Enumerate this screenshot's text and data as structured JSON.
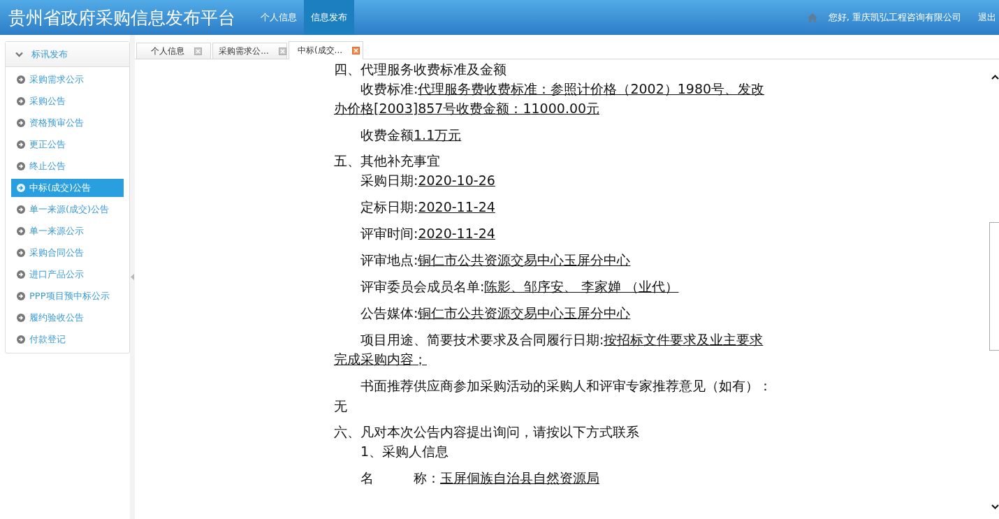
{
  "header": {
    "title": "贵州省政府采购信息发布平台",
    "nav": [
      {
        "label": "个人信息",
        "selected": false
      },
      {
        "label": "信息发布",
        "selected": true
      }
    ],
    "greeting": "您好, 重庆凯弘工程咨询有限公司",
    "logout": "退出"
  },
  "sidebar": {
    "title": "标讯发布",
    "expanded": true,
    "items": [
      {
        "label": "采购需求公示",
        "selected": false
      },
      {
        "label": "采购公告",
        "selected": false
      },
      {
        "label": "资格预审公告",
        "selected": false
      },
      {
        "label": "更正公告",
        "selected": false
      },
      {
        "label": "终止公告",
        "selected": false
      },
      {
        "label": "中标(成交)公告",
        "selected": true
      },
      {
        "label": "单一来源(成交)公告",
        "selected": false
      },
      {
        "label": "单一来源公示",
        "selected": false
      },
      {
        "label": "采购合同公告",
        "selected": false
      },
      {
        "label": "进口产品公示",
        "selected": false
      },
      {
        "label": "PPP项目预中标公示",
        "selected": false
      },
      {
        "label": "履约验收公告",
        "selected": false
      },
      {
        "label": "付款登记",
        "selected": false
      }
    ]
  },
  "tabs": [
    {
      "label": "个人信息",
      "selected": false
    },
    {
      "label": "采购需求公...",
      "selected": false
    },
    {
      "label": "中标(成交...",
      "selected": true
    }
  ],
  "document": [
    {
      "kind": "heading",
      "text": "四、代理服务收费标准及金额"
    },
    {
      "kind": "field",
      "label": "收费标准:",
      "value": "代理服务费收费标准：参照计价格（2002）1980号、发改办价格[2003]857号收费金额：11000.00元"
    },
    {
      "kind": "field",
      "label": "收费金额",
      "value": "1.1万元"
    },
    {
      "kind": "heading",
      "text": "五、其他补充事宜"
    },
    {
      "kind": "field",
      "label": "采购日期:",
      "value": "2020-10-26"
    },
    {
      "kind": "field",
      "label": "定标日期:",
      "value": "2020-11-24"
    },
    {
      "kind": "field",
      "label": "评审时间:",
      "value": "2020-11-24"
    },
    {
      "kind": "field",
      "label": "评审地点:",
      "value": "铜仁市公共资源交易中心玉屏分中心"
    },
    {
      "kind": "field",
      "label": "评审委员会成员名单:",
      "value": "陈影、邹序安、 李家婵 （业代）"
    },
    {
      "kind": "field",
      "label": "公告媒体:",
      "value": "铜仁市公共资源交易中心玉屏分中心"
    },
    {
      "kind": "field",
      "label": "项目用途、简要技术要求及合同履行日期:",
      "value": "按招标文件要求及业主要求完成采购内容；"
    },
    {
      "kind": "block",
      "text": "书面推荐供应商参加采购活动的采购人和评审专家推荐意见（如有）："
    },
    {
      "kind": "plain",
      "text": "无"
    },
    {
      "kind": "heading",
      "text": "六、凡对本次公告内容提出询问，请按以下方式联系"
    },
    {
      "kind": "text",
      "text": "1、采购人信息"
    },
    {
      "kind": "field",
      "label": "名　　　称：",
      "value": "玉屏侗族自治县自然资源局"
    }
  ]
}
